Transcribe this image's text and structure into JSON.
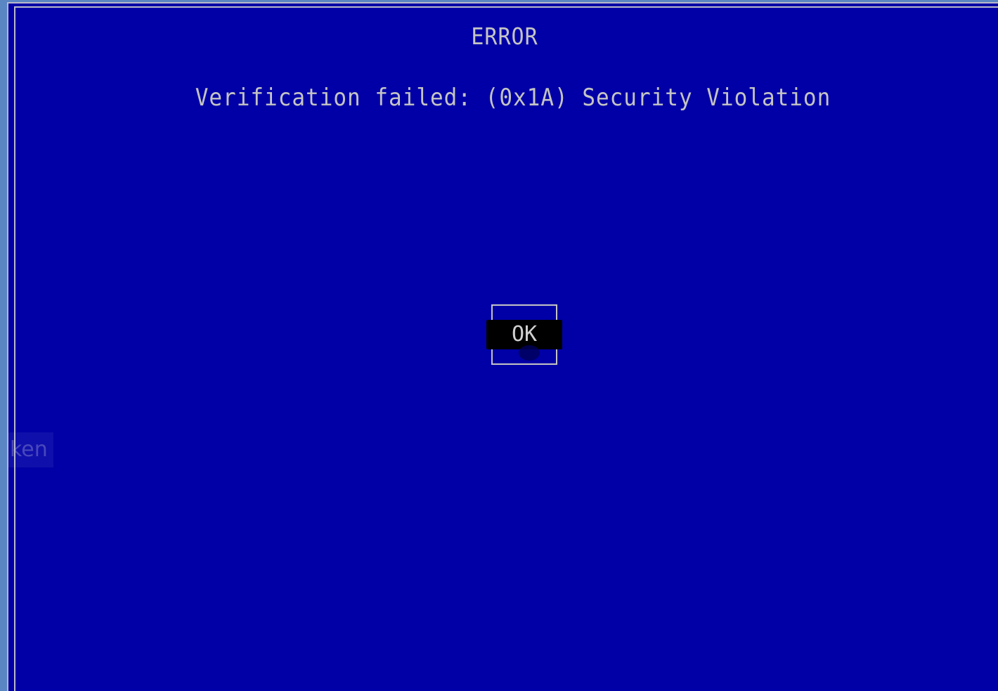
{
  "dialog": {
    "title": "ERROR",
    "message": "Verification failed: (0x1A) Security Violation",
    "ok_label": "OK"
  },
  "background_fragment": {
    "text": "ken"
  },
  "colors": {
    "background": "#0000a6",
    "text": "#c4c4c4",
    "button_bg": "#000000",
    "outer_desktop": "#5b86c4"
  }
}
